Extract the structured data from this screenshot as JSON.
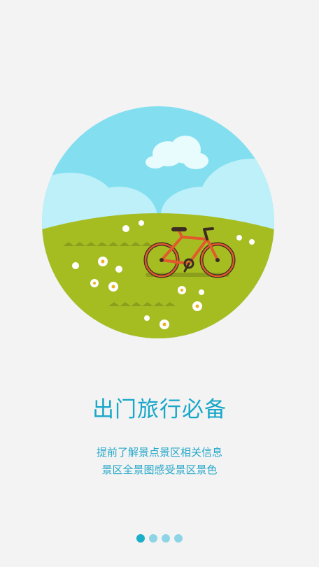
{
  "onboarding": {
    "headline": "出门旅行必备",
    "description_line1": "提前了解景点景区相关信息",
    "description_line2": "景区全景图感受景区景色",
    "pager": {
      "total_pages": 4,
      "current_page": 1
    },
    "illustration_icon": "bicycle-on-meadow-illustration"
  },
  "colors": {
    "background": "#f3f3f3",
    "accent": "#18a7c8",
    "dot_active": "#1aaec8",
    "dot_inactive": "#8dd5e6",
    "sky": "#83dff0",
    "grass": "#a6bd22",
    "bicycle": "#e05b2c"
  }
}
